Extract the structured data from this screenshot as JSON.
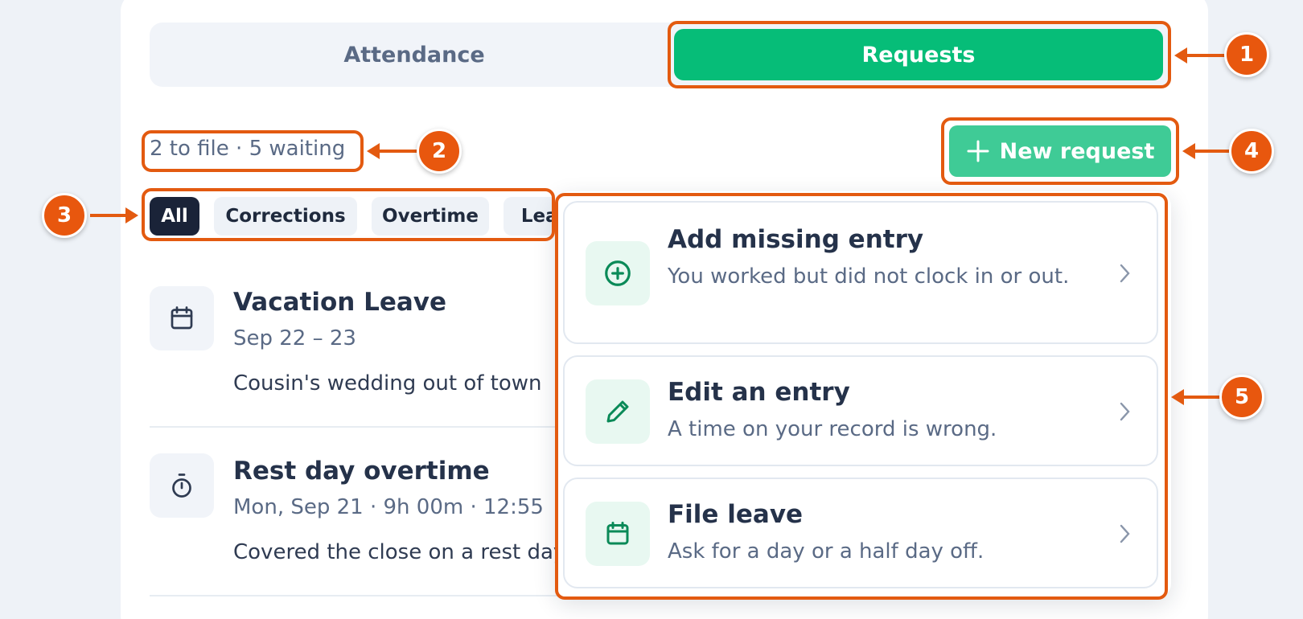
{
  "tabs": {
    "attendance": "Attendance",
    "requests": "Requests"
  },
  "summary": "2 to file · 5 waiting",
  "new_request": {
    "label": "New request",
    "icon": "plus-icon"
  },
  "filters": [
    "All",
    "Corrections",
    "Overtime",
    "Leave"
  ],
  "requests": [
    {
      "title": "Vacation Leave",
      "subtitle": "Sep 22 – 23",
      "note": "Cousin's wedding out of town",
      "icon": "calendar-icon"
    },
    {
      "title": "Rest day overtime",
      "subtitle": "Mon, Sep 21 · 9h 00m · 12:55",
      "note": "Covered the close on a rest day",
      "icon": "stopwatch-icon"
    }
  ],
  "menu": [
    {
      "title": "Add missing entry",
      "desc": "You worked but did not clock in or out.",
      "icon": "plus-circle-icon"
    },
    {
      "title": "Edit an entry",
      "desc": "A time on your record is wrong.",
      "icon": "pencil-icon"
    },
    {
      "title": "File leave",
      "desc": "Ask for a day or a half day off.",
      "icon": "calendar-icon"
    }
  ],
  "callouts": [
    "1",
    "2",
    "3",
    "4",
    "5"
  ],
  "colors": {
    "accent": "#06bd78",
    "accent_soft": "#3fcb96",
    "callout": "#e35a10",
    "chip_active": "#1a2338"
  }
}
